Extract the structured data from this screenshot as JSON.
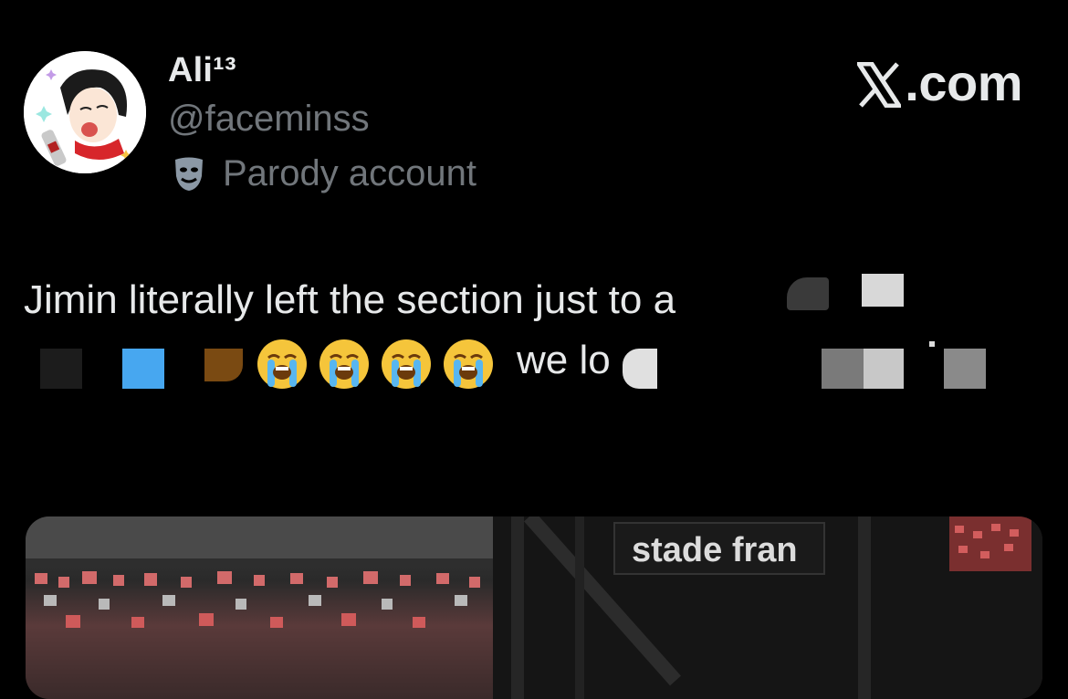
{
  "author": {
    "display_name": "Ali¹³",
    "handle": "@faceminss",
    "label": "Parody account",
    "label_icon": "theater-mask-icon"
  },
  "brand": {
    "text": ".com",
    "logo": "x-logo-icon"
  },
  "tweet": {
    "line1": "Jimin  literally left the section just to a",
    "line2_tail": "we lo",
    "emoji": [
      "loudly-crying-face",
      "loudly-crying-face",
      "loudly-crying-face",
      "loudly-crying-face"
    ]
  },
  "media": {
    "sign_text": "stade fran"
  },
  "colors": {
    "background": "#000000",
    "primary_text": "#e7e9ea",
    "secondary_text": "#71767b"
  }
}
